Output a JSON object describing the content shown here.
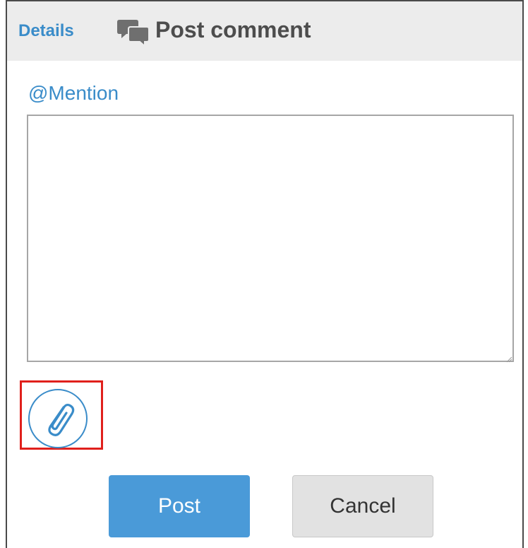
{
  "header": {
    "breadcrumb_link": "Details",
    "title": "Post comment",
    "title_icon": "chat-bubbles-icon"
  },
  "form": {
    "mention_link": "@Mention",
    "comment_value": "",
    "attach_icon": "paperclip-icon"
  },
  "actions": {
    "post_label": "Post",
    "cancel_label": "Cancel"
  },
  "colors": {
    "accent": "#3a8cc9",
    "post_button": "#4a9ad8",
    "cancel_button": "#e2e2e2",
    "highlight": "#e0201c",
    "header_bg": "#ececec"
  }
}
